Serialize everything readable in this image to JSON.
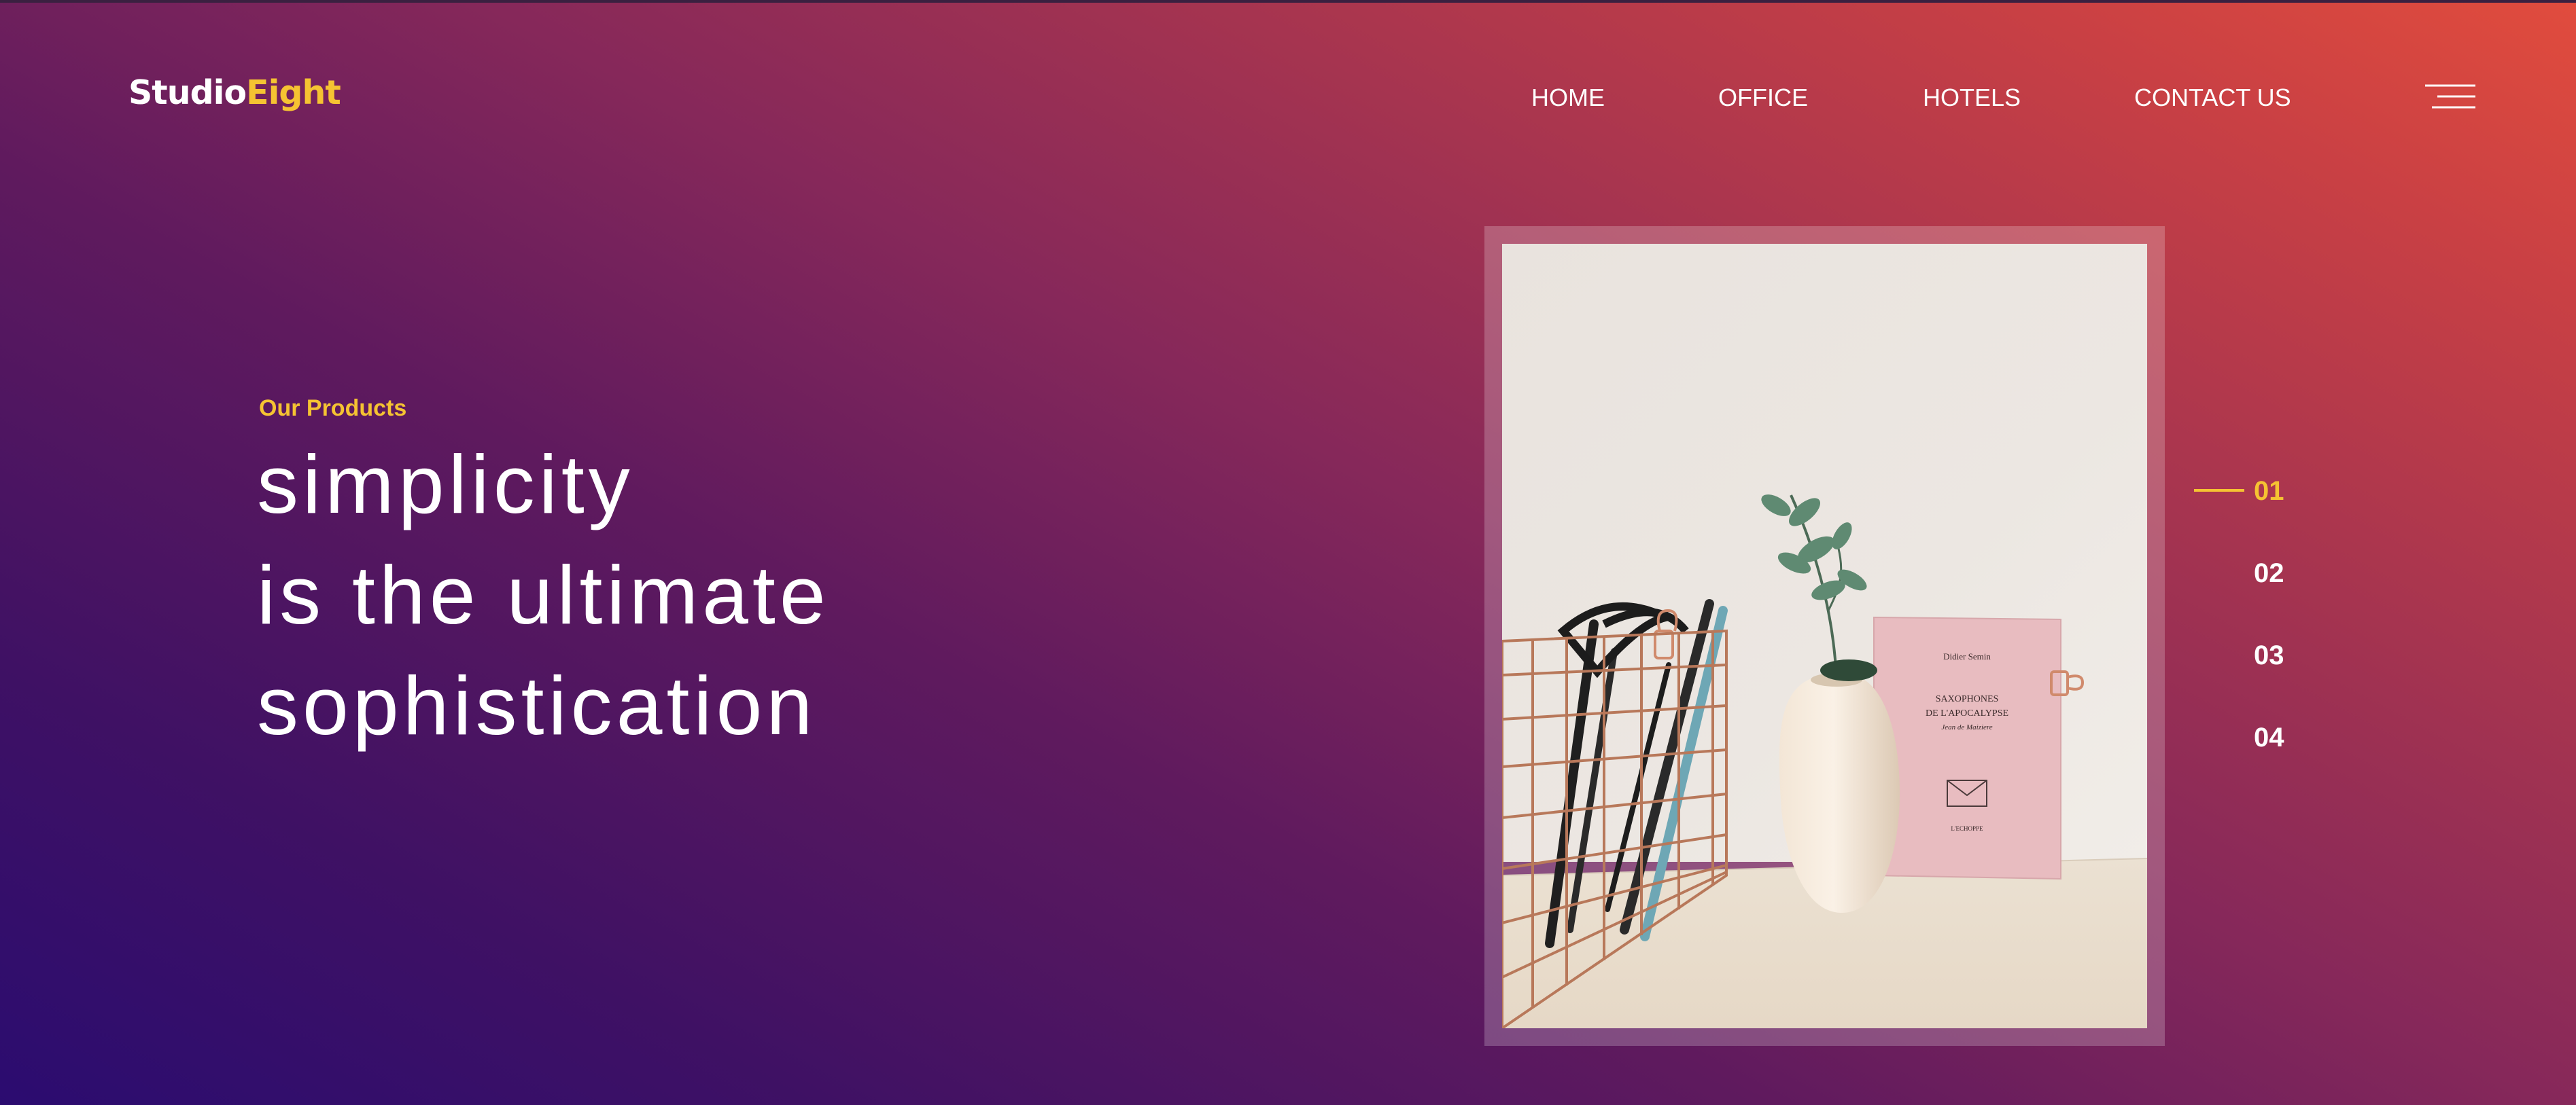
{
  "brand": {
    "logo_part1": "Studio",
    "logo_part2": "Eight",
    "accent_color": "#f5c332"
  },
  "nav": {
    "items": [
      {
        "label": "HOME"
      },
      {
        "label": "OFFICE"
      },
      {
        "label": "HOTELS"
      },
      {
        "label": "CONTACT US"
      }
    ],
    "menu_icon": "hamburger-menu-icon"
  },
  "hero": {
    "eyebrow": "Our Products",
    "headline_lines": [
      "simplicity",
      "is the ultimate",
      "sophistication"
    ]
  },
  "featured_image": {
    "book": {
      "author": "Didier Semin",
      "title_line1": "SAXOPHONES",
      "title_line2": "DE L'APOCALYPSE",
      "subtitle": "Jean de Maiziere",
      "publisher": "L'ECHOPPE"
    }
  },
  "pager": {
    "active_index": 0,
    "items": [
      {
        "label": "01"
      },
      {
        "label": "02"
      },
      {
        "label": "03"
      },
      {
        "label": "04"
      }
    ]
  },
  "colors": {
    "gradient_start": "#2b0c70",
    "gradient_end": "#e14c3d",
    "text": "#ffffff"
  }
}
